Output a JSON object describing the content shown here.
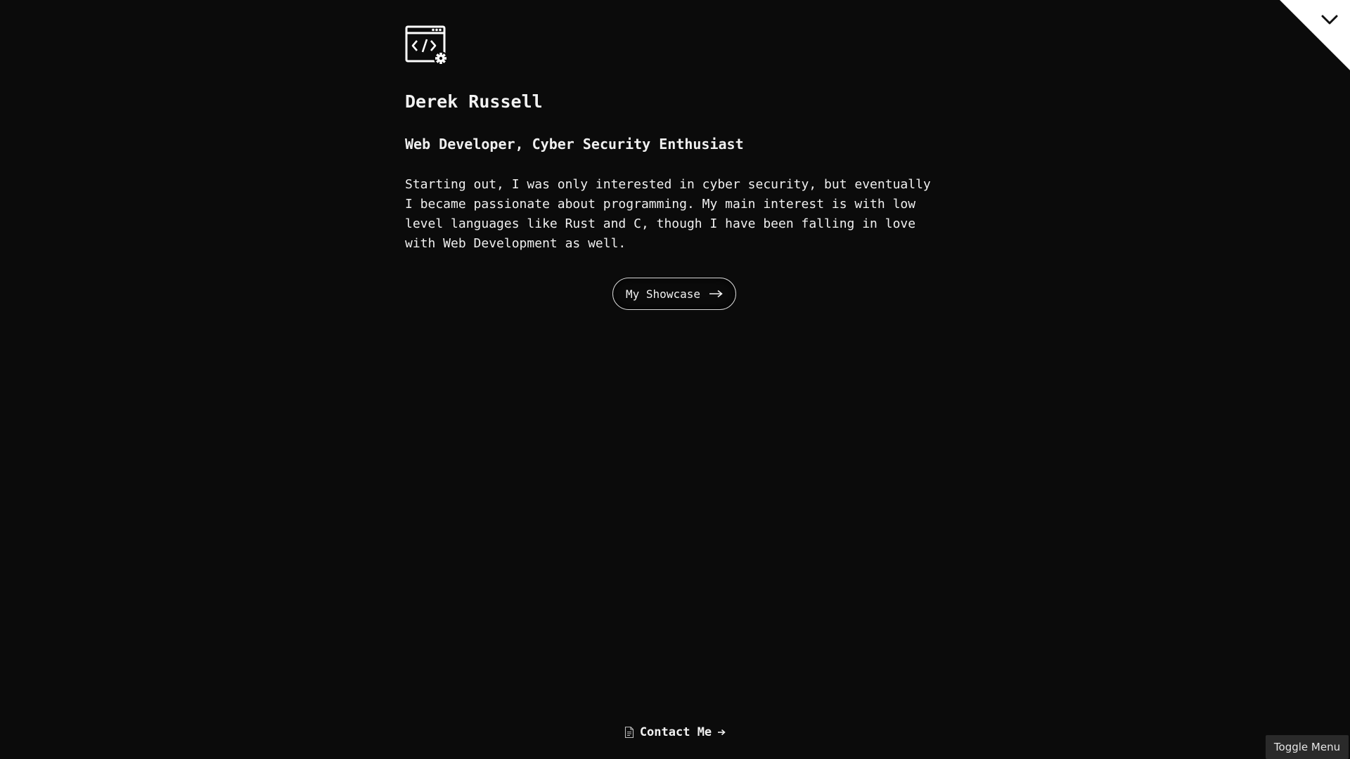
{
  "profile": {
    "name": "Derek Russell",
    "tagline": "Web Developer, Cyber Security Enthusiast",
    "bio_lines": [
      "Starting out, I was only interested in cyber security, but eventually",
      "I became passionate about programming. My main interest is with low",
      "level languages like Rust and C, though I have been falling in love",
      "with Web Development as well."
    ]
  },
  "actions": {
    "showcase_label": "My Showcase",
    "contact_label": "Contact Me",
    "toggle_menu_label": "Toggle Menu"
  },
  "icons": {
    "logo": "code-window-gear-icon",
    "showcase_arrow": "arrow-right-icon",
    "contact_doc": "document-icon",
    "contact_arrow": "arrow-right-icon",
    "corner_toggle": "chevron-down-icon"
  },
  "colors": {
    "background": "#0b0b0b",
    "text": "#f2f2f2",
    "toggle_bg": "#2a2a2a"
  }
}
